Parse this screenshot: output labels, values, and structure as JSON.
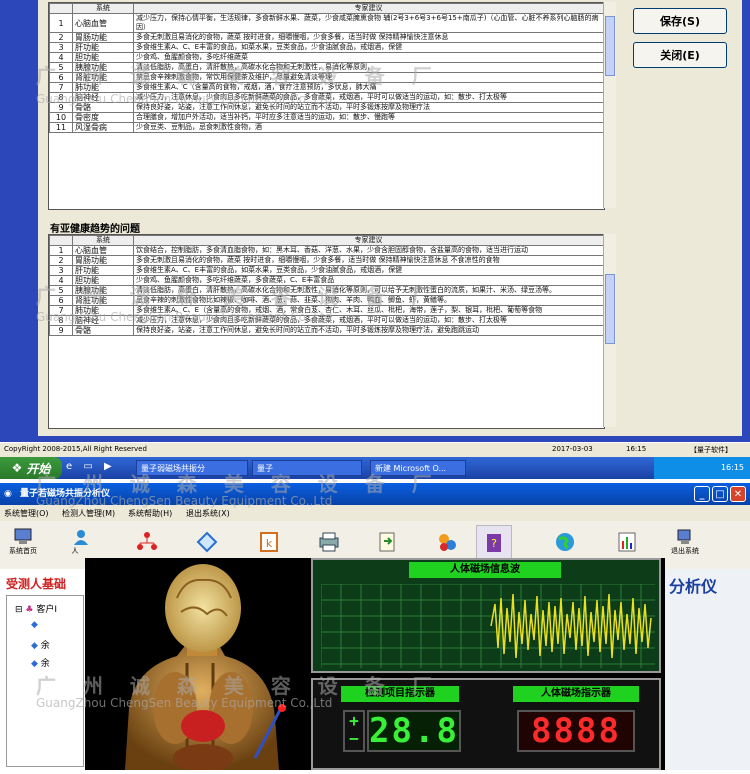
{
  "report": {
    "group1_header_system": "系统",
    "group1_header_advice": "专家建议",
    "group1_rows": [
      {
        "no": "1",
        "system": "心脑血管",
        "advice": "减少压力，保持心情平衡，生活规律，多食新鲜水果、蔬菜，少食咸菜腌熏食物 辅(2号3+6号3+6号15+南瓜子)（心血管、心脏不养系列心脑肠的病因）"
      },
      {
        "no": "2",
        "system": "胃肠功能",
        "advice": "多食无刺激且易消化的食物，蔬菜 按时进食，细嚼慢咽，少食多餐，适当时做 保持精神愉快注意休息"
      },
      {
        "no": "3",
        "system": "肝功能",
        "advice": "多食维生素A、C、E丰富的食品，如菜水果，豆类食品，少食油腻食品，戒烟酒，保健"
      },
      {
        "no": "4",
        "system": "胆功能",
        "advice": "少食鸡、鱼腥颜食物，多吃纤维蔬菜"
      },
      {
        "no": "5",
        "system": "胰腺功能",
        "advice": "清淡低脂肪，高蛋白，清肝散热，高碳水化合物和无刺激性，易消化等原则，"
      },
      {
        "no": "6",
        "system": "肾脏功能",
        "advice": "禁忌食辛辣刺激食物，常饮用保健茶及维护，尽量避免清淡等理"
      },
      {
        "no": "7",
        "system": "肺功能",
        "advice": "多食维生素A、C（含量高的食物，戒烟，酒，食疗注意预防，多伏息，肺大痛"
      },
      {
        "no": "8",
        "system": "脑神经",
        "advice": "减少压力，注意休息，少食肉且多吃新鲜蔬菜的食品，多食蔬菜，戒烟酒，平时可以做适当的运动，如：散步、打太极等"
      },
      {
        "no": "9",
        "system": "骨骼",
        "advice": "保持良好姿，站姿，注意工作间休息，避免长时间的站立而不活动，平时多锻炼按摩及物理疗法"
      },
      {
        "no": "10",
        "system": "骨密度",
        "advice": "合理膳食，增加户外活动，适当补钙，平时应多注意适当的运动，如：散步、慢跑等"
      },
      {
        "no": "11",
        "system": "风湿骨病",
        "advice": "少食豆类、豆制品，忌食刺激性食物，酒"
      }
    ],
    "group2_title": "有亚健康趋势的问题",
    "group2_header_system": "系统",
    "group2_header_advice": "专家建议",
    "group2_rows": [
      {
        "no": "1",
        "system": "心脑血管",
        "advice": "饮食结合，控制脂肪，多食清血脂食物，如：黑木耳、香菇、洋葱、水果，少食含胆固醇食物，含盐量高的食物，适当进行运动"
      },
      {
        "no": "2",
        "system": "胃肠功能",
        "advice": "多食无刺激且易消化的食物，蔬菜 按时进食，细嚼慢咽，少食多餐，适当时做 保持精神愉快注意休息 不食凉性的食物"
      },
      {
        "no": "3",
        "system": "肝功能",
        "advice": "多食维生素A、C、E丰富的食品，如菜水果，豆类食品，少食油腻食品，戒烟酒，保健"
      },
      {
        "no": "4",
        "system": "胆功能",
        "advice": "少食鸡、鱼腥颜食物，多吃纤维蔬菜，多食蔬菜，C、E丰富食品"
      },
      {
        "no": "5",
        "system": "胰腺功能",
        "advice": "清淡低脂肪，高蛋白，清肝散热，高碳水化合物和无刺激性，易消化等原则，可以给予无刺激性蛋白的流质，如果汁、米汤、绿豆汤等。"
      },
      {
        "no": "6",
        "system": "肾脏功能",
        "advice": "忌食辛辣的刺激性食物比如辣椒、咖啡、酒、葱、蒜、韭菜、狗肉、羊肉、鸭血、鲫鱼、虾，黄鳝等。"
      },
      {
        "no": "7",
        "system": "肺功能",
        "advice": "多食维生素A、C、E（含量高的食物，戒烟、酒，常食白芨、杏仁、木耳、丝瓜、枇杷，海带，莲子，梨、银耳，枇杷、葡萄等食物"
      },
      {
        "no": "8",
        "system": "脑神经",
        "advice": "减少压力，注意休息，少食肉且多吃新鲜蔬菜的食品，多食蔬菜，戒烟酒，平时可以做适当的运动，如：散步、打太极等"
      },
      {
        "no": "9",
        "system": "骨骼",
        "advice": "保持良好姿，站姿，注意工作间休息，避免长时间的站立而不活动，平时多锻炼按摩及物理疗法，避免跑跳运动"
      }
    ],
    "save_button": "保存(S)",
    "close_button": "关闭(E)"
  },
  "statusbar": {
    "copyright": "CopyRight 2008-2015,All Right Reserved",
    "date": "2017-03-03",
    "time": "16:15",
    "vendor": "【量子软件】"
  },
  "taskbar": {
    "start": "开始",
    "tasks": [
      "量子弱磁场共振分",
      "量子",
      "新建 Microsoft O..."
    ],
    "clock": "16:15"
  },
  "app2": {
    "title": "量子若磁场共振分析仪",
    "menu": [
      "系统管理(O)",
      "检测人管理(M)",
      "系统帮助(H)",
      "退出系统(X)"
    ],
    "toolbar_home": "系统首页",
    "toolbar_person": "人",
    "toolbar_exit": "退出系统",
    "left_title": "受测人基础",
    "tree_root": "客户I",
    "tree_item_marker": "余",
    "right_title": "分析仪",
    "waveform_title": "人体磁场信息波",
    "detect_label": "检测项目指示器",
    "magnet_label": "人体磁场指示器",
    "detect_value": "28.8",
    "magnet_value": "8888",
    "plus": "+",
    "minus": "−"
  },
  "watermark": {
    "cn": "广 州 诚 森 美 容 设 备 厂",
    "en": "GuangZhou ChengSen Beauty Equipment Co.,Ltd"
  },
  "colors": {
    "dialog_bg": "#ece9d8",
    "title_blue": "#0842a8",
    "scope_green": "#0d3d18",
    "wave_yellow": "#e8e020",
    "led_green": "#38f038",
    "led_red": "#ff2a2a"
  }
}
